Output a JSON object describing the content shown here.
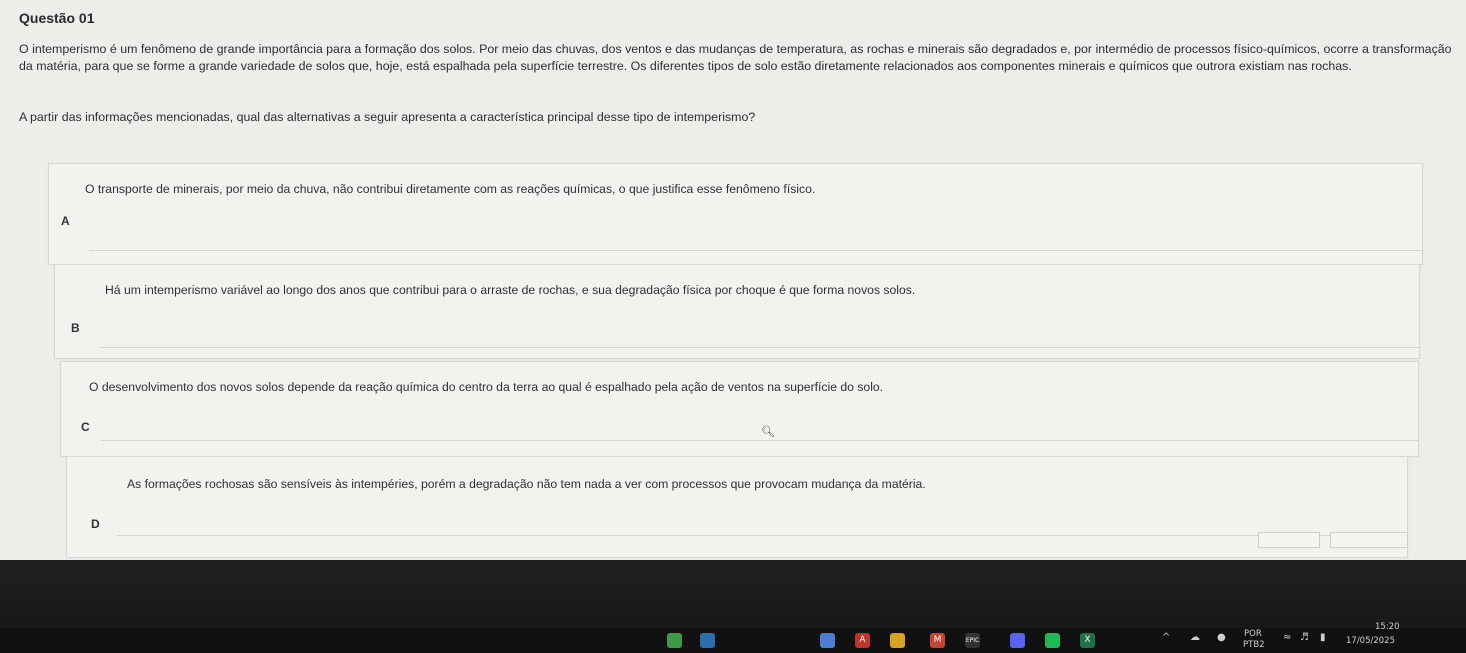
{
  "question": {
    "title": "Questão 01",
    "statement": "O intemperismo é um fenômeno de grande importância para a formação dos solos. Por meio das chuvas, dos ventos e das mudanças de temperatura, as rochas e minerais são degradados e, por intermédio de processos físico-químicos, ocorre a transformação da matéria, para que se forme a grande variedade de solos que, hoje, está espalhada pela superfície terrestre. Os diferentes tipos de solo estão diretamente relacionados aos componentes minerais e químicos que outrora existiam nas rochas.",
    "prompt": "A partir das informações mencionadas, qual das alternativas a seguir apresenta a característica principal desse tipo de intemperismo?"
  },
  "options": [
    {
      "letter": "A",
      "text": "O transporte de minerais, por meio da chuva, não contribui diretamente com as reações químicas, o que justifica esse fenômeno físico."
    },
    {
      "letter": "B",
      "text": "Há um intemperismo variável ao longo dos anos que contribui para o arraste de rochas, e sua degradação física por choque é que forma novos solos."
    },
    {
      "letter": "C",
      "text": "O desenvolvimento dos novos solos depende da reação química do centro da terra ao qual é espalhado pela ação de ventos na superfície do solo."
    },
    {
      "letter": "D",
      "text": "As formações rochosas são sensíveis às intempéries, porém a degradação não tem nada a ver com processos que provocam mudança da matéria."
    }
  ],
  "taskbar": {
    "language": "POR",
    "keyboard": "PTB2",
    "time": "15:20",
    "date": "17/05/2025",
    "apps": [
      {
        "icon": "chrome-icon",
        "color": "#3d9a4a",
        "glyph": ""
      },
      {
        "icon": "app-icon",
        "color": "#2b6fb3",
        "glyph": ""
      },
      {
        "icon": "maps-icon",
        "color": "#4a7fd4",
        "glyph": ""
      },
      {
        "icon": "acrobat-icon",
        "color": "#c0332b",
        "glyph": "A"
      },
      {
        "icon": "notes-icon",
        "color": "#d9a520",
        "glyph": ""
      },
      {
        "icon": "gmail-icon",
        "color": "#c94333",
        "glyph": "M"
      },
      {
        "icon": "epic-games-icon",
        "color": "#333333",
        "glyph": "EPIC"
      },
      {
        "icon": "discord-icon",
        "color": "#5865f2",
        "glyph": ""
      },
      {
        "icon": "spotify-icon",
        "color": "#1db954",
        "glyph": ""
      },
      {
        "icon": "excel-icon",
        "color": "#1f7244",
        "glyph": "X"
      }
    ]
  }
}
